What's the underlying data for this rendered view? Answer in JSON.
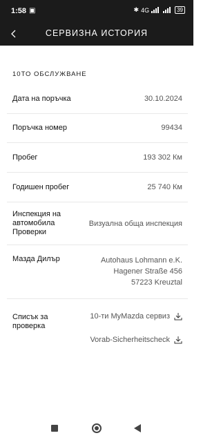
{
  "status": {
    "time": "1:58",
    "network": "4G",
    "battery": "39"
  },
  "header": {
    "title": "СЕРВИЗНА ИСТОРИЯ"
  },
  "section": {
    "title": "10ТО ОБСЛУЖВАНЕ"
  },
  "rows": [
    {
      "label": "Дата на поръчка",
      "value": "30.10.2024"
    },
    {
      "label": "Поръчка номер",
      "value": "99434"
    },
    {
      "label": "Пробег",
      "value": "193 302 Км"
    },
    {
      "label": "Годишен пробег",
      "value": "25 740 Км"
    },
    {
      "label_lines": [
        "Инспекция на",
        "автомобила",
        "Проверки"
      ],
      "value": "Визуална  обща инспекция"
    },
    {
      "label": "Мазда Дилър",
      "value_lines": [
        "Autohaus Lohmann e.K.",
        "Hagener Straße 456",
        "57223 Kreuztal"
      ]
    }
  ],
  "checklist": {
    "label_lines": [
      "Списък за",
      "проверка"
    ],
    "documents": [
      {
        "label": "10-ти MyMazda сервиз"
      },
      {
        "label": "Vorab-Sicherheitscheck"
      }
    ]
  }
}
